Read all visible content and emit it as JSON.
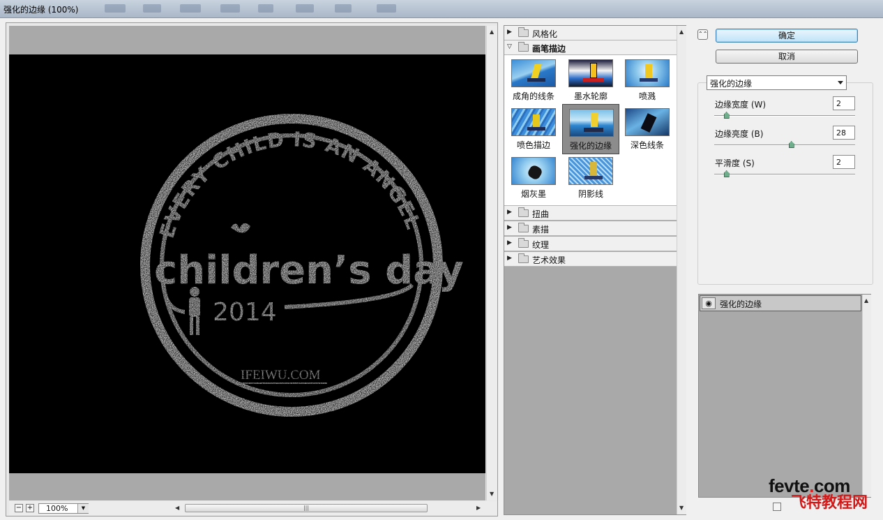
{
  "window": {
    "title": "强化的边缘 (100%)"
  },
  "preview": {
    "zoom": "100%",
    "image_text": {
      "arc": "EVERY CHILD IS AN ANGEL",
      "main": "children’s day",
      "year": "2014",
      "site": "IFEIWU.COM"
    }
  },
  "gallery": {
    "categories_top": [
      {
        "label": "风格化",
        "expanded": false
      },
      {
        "label": "画笔描边",
        "expanded": true
      }
    ],
    "thumbnails": [
      {
        "label": "成角的线条",
        "selected": false
      },
      {
        "label": "墨水轮廓",
        "selected": false
      },
      {
        "label": "喷溅",
        "selected": false
      },
      {
        "label": "喷色描边",
        "selected": false
      },
      {
        "label": "强化的边缘",
        "selected": true
      },
      {
        "label": "深色线条",
        "selected": false
      },
      {
        "label": "烟灰墨",
        "selected": false
      },
      {
        "label": "阴影线",
        "selected": false
      }
    ],
    "categories_bottom": [
      {
        "label": "扭曲"
      },
      {
        "label": "素描"
      },
      {
        "label": "纹理"
      },
      {
        "label": "艺术效果"
      }
    ]
  },
  "buttons": {
    "ok": "确定",
    "cancel": "取消"
  },
  "filter_select": {
    "value": "强化的边缘"
  },
  "params": [
    {
      "label": "边缘宽度 (W)",
      "value": "2",
      "level": 0.07
    },
    {
      "label": "边缘亮度 (B)",
      "value": "28",
      "level": 0.55
    },
    {
      "label": "平滑度 (S)",
      "value": "2",
      "level": 0.07
    }
  ],
  "layers": [
    {
      "name": "强化的边缘"
    }
  ],
  "watermark": {
    "line1_a": "fevte",
    "line1_b": ".",
    "line1_c": "com",
    "line2": "飞特教程网"
  },
  "colors": {
    "ok_accent": "#3c7fb1",
    "knob": "#6fae8c",
    "watermark_red": "#d41818"
  }
}
